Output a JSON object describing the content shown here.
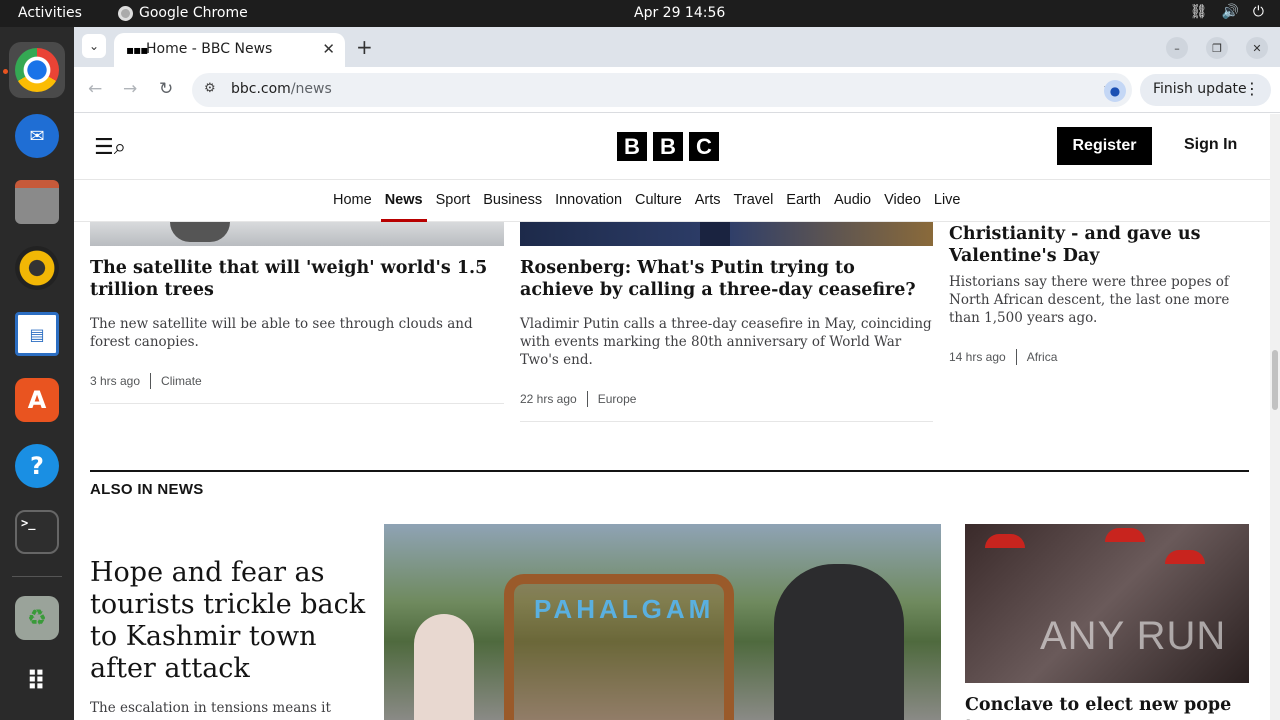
{
  "system": {
    "activities": "Activities",
    "app_name": "Google Chrome",
    "clock": "Apr 29  14:56"
  },
  "dock": {
    "items": [
      "chrome-icon",
      "thunderbird-icon",
      "files-icon",
      "rhythmbox-icon",
      "writer-icon",
      "app-center-icon",
      "help-icon",
      "terminal-icon",
      "trash-icon",
      "app-grid-icon"
    ]
  },
  "browser": {
    "tab_title": "Home - BBC News",
    "url_domain": "bbc.com",
    "url_path": "/news",
    "update_label": "Finish update"
  },
  "bbc": {
    "logo": [
      "B",
      "B",
      "C"
    ],
    "register_label": "Register",
    "signin_label": "Sign In",
    "nav": [
      "Home",
      "News",
      "Sport",
      "Business",
      "Innovation",
      "Culture",
      "Arts",
      "Travel",
      "Earth",
      "Audio",
      "Video",
      "Live"
    ],
    "nav_active": "News"
  },
  "articles": {
    "a1": {
      "headline": "The satellite that will 'weigh' world's 1.5 trillion trees",
      "summary": "The new satellite will be able to see through clouds and forest canopies.",
      "time": "3 hrs ago",
      "section": "Climate"
    },
    "a2": {
      "headline": "Rosenberg: What's Putin trying to achieve by calling a three-day ceasefire?",
      "summary": "Vladimir Putin calls a three-day ceasefire in May, coinciding with events marking the 80th anniversary of World War Two's end.",
      "time": "22 hrs ago",
      "section": "Europe"
    },
    "a3": {
      "headline": "Christianity - and gave us Valentine's Day",
      "summary": "Historians say there were three popes of North African descent, the last one more than 1,500 years ago.",
      "time": "14 hrs ago",
      "section": "Africa"
    }
  },
  "also_in_news": {
    "heading": "ALSO IN NEWS",
    "lead_headline": "Hope and fear as tourists trickle back to Kashmir town after attack",
    "lead_summary": "The escalation in tensions means it",
    "sign_text": "PAHALGAM",
    "watermark": "ANY RUN",
    "right_headline": "Conclave to elect new pope to"
  }
}
